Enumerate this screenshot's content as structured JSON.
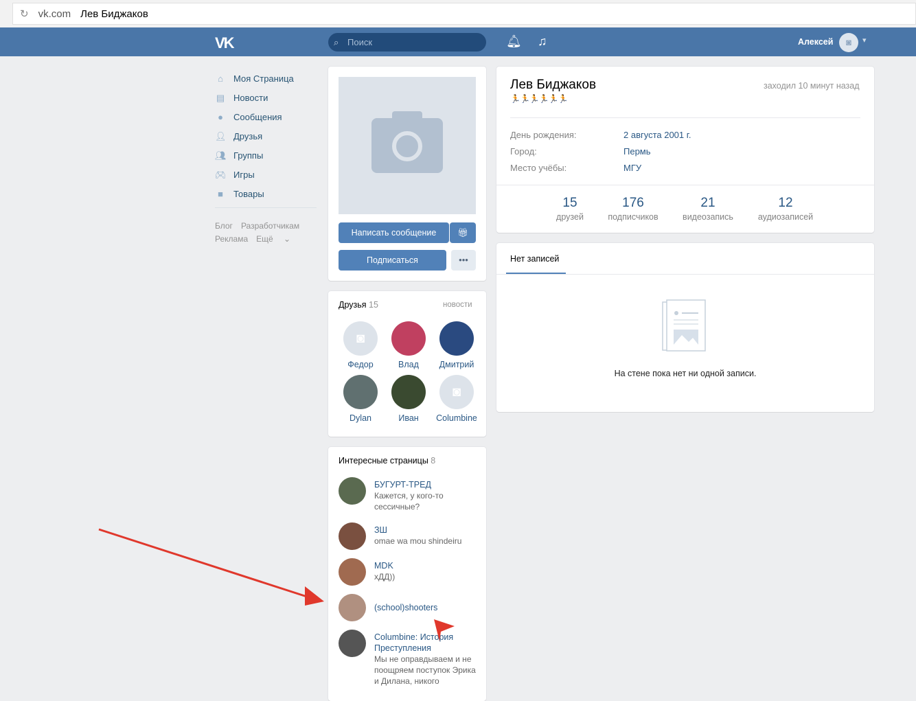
{
  "browser": {
    "domain": "vk.com",
    "title": "Лев Биджаков"
  },
  "header": {
    "logo": "VK",
    "search_placeholder": "Поиск",
    "user_name": "Алексей"
  },
  "menu": [
    {
      "label": "Моя Страница",
      "icon": "home-icon"
    },
    {
      "label": "Новости",
      "icon": "news-icon"
    },
    {
      "label": "Сообщения",
      "icon": "messages-icon"
    },
    {
      "label": "Друзья",
      "icon": "friends-icon"
    },
    {
      "label": "Группы",
      "icon": "groups-icon"
    },
    {
      "label": "Игры",
      "icon": "games-icon"
    },
    {
      "label": "Товары",
      "icon": "market-icon"
    }
  ],
  "footer": {
    "blog": "Блог",
    "dev": "Разработчикам",
    "ads": "Реклама",
    "more": "Ещё"
  },
  "profile": {
    "name": "Лев Биджаков",
    "status": "🏃🏃🏃🏃🏃🏃",
    "last_seen": "заходил 10 минут назад",
    "info": [
      {
        "label": "День рождения:",
        "value": "2 августа 2001 г."
      },
      {
        "label": "Город:",
        "value": "Пермь"
      },
      {
        "label": "Место учёбы:",
        "value": "МГУ"
      }
    ],
    "counters": [
      {
        "n": "15",
        "l": "друзей"
      },
      {
        "n": "176",
        "l": "подписчиков"
      },
      {
        "n": "21",
        "l": "видеозапись"
      },
      {
        "n": "12",
        "l": "аудиозаписей"
      }
    ]
  },
  "actions": {
    "message": "Написать сообщение",
    "subscribe": "Подписаться",
    "more": "•••"
  },
  "friends": {
    "title": "Друзья",
    "count": "15",
    "news": "новости",
    "list": [
      {
        "name": "Федор",
        "color": "#dde3ea"
      },
      {
        "name": "Влад",
        "color": "#c04060"
      },
      {
        "name": "Дмитрий",
        "color": "#2a4a80"
      },
      {
        "name": "Dylan",
        "color": "#607070"
      },
      {
        "name": "Иван",
        "color": "#3a4a30"
      },
      {
        "name": "Columbine",
        "color": "#dde3ea"
      }
    ]
  },
  "pages": {
    "title": "Интересные страницы",
    "count": "8",
    "list": [
      {
        "name": "БУГУРТ-ТРЕД",
        "sub": "Кажется, у кого-то сессичные?",
        "color": "#5a6a50"
      },
      {
        "name": "ЗШ",
        "sub": "omae wa mou shindeiru",
        "color": "#7a5040"
      },
      {
        "name": "MDK",
        "sub": "хДД))",
        "color": "#a06a50"
      },
      {
        "name": "(school)shooters",
        "sub": "",
        "color": "#b09080"
      },
      {
        "name": "Columbine: История Преступления",
        "sub": "Мы не оправдываем и не поощряем поступок Эрика и Дилана, никого",
        "color": "#555"
      }
    ]
  },
  "wall": {
    "tab": "Нет записей",
    "empty": "На стене пока нет ни одной записи."
  },
  "colors": {
    "header": "#4a76a8",
    "accent": "#5181b8",
    "arrow": "#e0382c"
  }
}
